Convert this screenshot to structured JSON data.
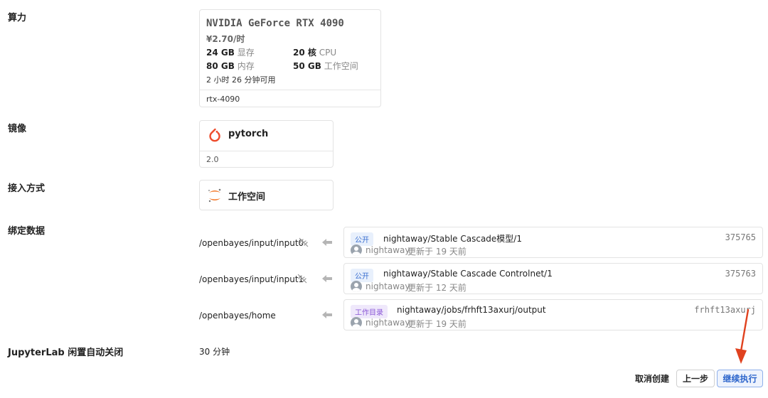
{
  "compute": {
    "label": "算力",
    "gpu_name": "NVIDIA GeForce RTX 4090",
    "price": "¥2.70/时",
    "gpu_mem_value": "24 GB",
    "gpu_mem_unit": "显存",
    "cpu_value": "20 核",
    "cpu_unit": "CPU",
    "mem_value": "80 GB",
    "mem_unit": "内存",
    "disk_value": "50 GB",
    "disk_unit": "工作空间",
    "available": "2 小时 26 分钟可用",
    "slug": "rtx-4090"
  },
  "image": {
    "label": "镜像",
    "name": "pytorch",
    "version": "2.0",
    "icon": "pytorch-icon",
    "icon_color": "#ee4c2c"
  },
  "access": {
    "label": "接入方式",
    "name": "工作空间",
    "icon": "jupyter-icon",
    "icon_color": "#f37626"
  },
  "bindings": {
    "label": "绑定数据",
    "items": [
      {
        "path": "/openbayes/input/input0",
        "badge": "公开",
        "name": "nightaway/Stable Cascade模型/1",
        "id": "375765",
        "user": "nightaway",
        "updated": "更新于 19 天前"
      },
      {
        "path": "/openbayes/input/input1",
        "badge": "公开",
        "name": "nightaway/Stable Cascade Controlnet/1",
        "id": "375763",
        "user": "nightaway",
        "updated": "更新于 12 天前"
      },
      {
        "path": "/openbayes/home",
        "badge": "工作目录",
        "name": "nightaway/jobs/frhft13axurj/output",
        "id": "frhft13axurj",
        "user": "nightaway",
        "updated": "更新于 19 天前"
      }
    ]
  },
  "idle": {
    "label": "JupyterLab 闲置自动关闭",
    "value": "30 分钟"
  },
  "actions": {
    "cancel": "取消创建",
    "prev": "上一步",
    "continue": "继续执行"
  },
  "colors": {
    "annotation_arrow": "#e0421f",
    "primary": "#2e66cc"
  }
}
